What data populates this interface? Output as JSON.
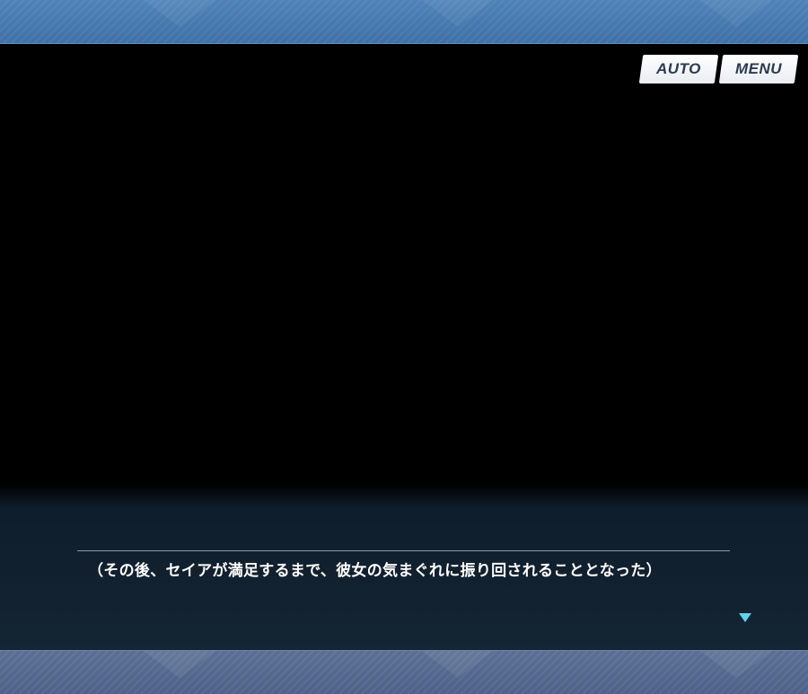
{
  "controls": {
    "auto_label": "AUTO",
    "menu_label": "MENU"
  },
  "dialogue": {
    "text": "（その後、セイアが満足するまで、彼女の気まぐれに振り回されることとなった）"
  },
  "icons": {
    "advance": "triangle-down-icon"
  },
  "colors": {
    "top_band": "#4f83b8",
    "bottom_band": "#5b6f95",
    "dialogue_bg": "#12212f",
    "advance_indicator": "#5fd3ef",
    "button_text": "#2b3a52"
  }
}
